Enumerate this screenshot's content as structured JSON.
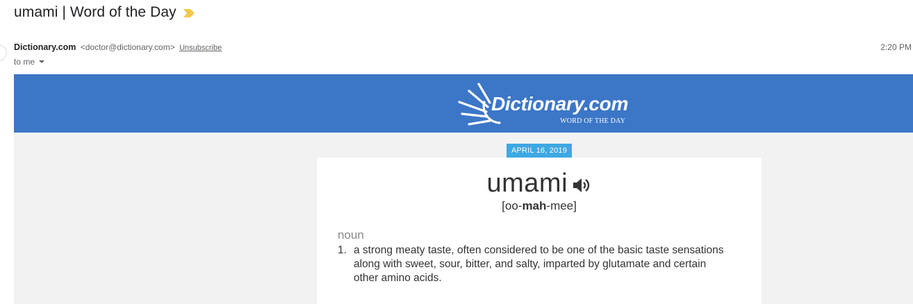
{
  "email": {
    "subject": "umami | Word of the Day",
    "sender_name": "Dictionary.com",
    "sender_email": "<doctor@dictionary.com>",
    "unsubscribe_label": "Unsubscribe",
    "time": "2:20 PM",
    "recipient": "to me"
  },
  "banner": {
    "logo_text": "Dictionary.com",
    "tagline": "WORD OF THE DAY",
    "background": "#3c76c7"
  },
  "entry": {
    "date": "APRIL 16, 2019",
    "word": "umami",
    "pronunciation": {
      "open": "[",
      "pre": "oo-",
      "stressed": "mah",
      "post": "-mee",
      "close": "]"
    },
    "part_of_speech": "noun",
    "definitions": [
      {
        "number": "1.",
        "text": "a strong meaty taste, often considered to be one of the basic taste sensations along with sweet, sour, bitter, and salty, imparted by glutamate and certain other amino acids."
      }
    ]
  },
  "icons": {
    "importance": "importance-marker-icon",
    "speaker": "speaker-icon",
    "caret": "caret-down-icon",
    "logo_rays": "sun-rays-icon"
  },
  "colors": {
    "date_badge": "#3ea8e3",
    "importance": "#f2c94c",
    "body_background": "#f2f2f2"
  }
}
